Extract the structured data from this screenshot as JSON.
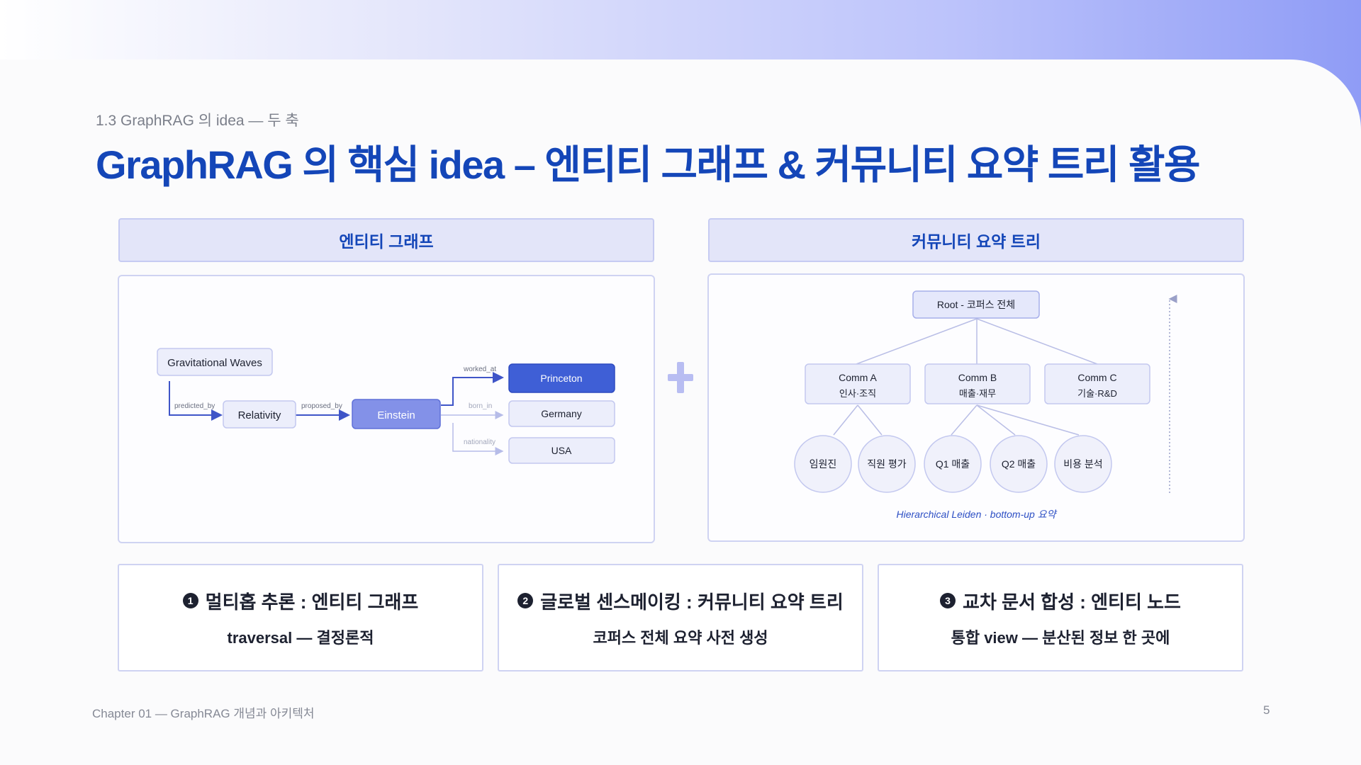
{
  "section_label": "1.3 GraphRAG 의 idea — 두 축",
  "title": "GraphRAG 의 핵심 idea – 엔티티 그래프 & 커뮤니티 요약 트리 활용",
  "left_header": "엔티티 그래프",
  "right_header": "커뮤니티 요약 트리",
  "entity_graph": {
    "nodes": {
      "waves": "Gravitational Waves",
      "relativity": "Relativity",
      "einstein": "Einstein",
      "princeton": "Princeton",
      "germany": "Germany",
      "usa": "USA"
    },
    "edges": {
      "predicted_by": "predicted_by",
      "proposed_by": "proposed_by",
      "worked_at": "worked_at",
      "born_in": "born_in",
      "nationality": "nationality"
    }
  },
  "community_tree": {
    "root": "Root - 코퍼스 전체",
    "comm_a": {
      "name": "Comm A",
      "sub": "인사·조직"
    },
    "comm_b": {
      "name": "Comm B",
      "sub": "매출·재무"
    },
    "comm_c": {
      "name": "Comm C",
      "sub": "기술·R&D"
    },
    "leaves": [
      "임원진",
      "직원 평가",
      "Q1 매출",
      "Q2 매출",
      "비용 분석"
    ],
    "caption": "Hierarchical Leiden · bottom-up 요약"
  },
  "cards": [
    {
      "num": "1",
      "head": "멀티홉 추론 : 엔티티 그래프",
      "sub": "traversal — 결정론적"
    },
    {
      "num": "2",
      "head": "글로벌 센스메이킹 : 커뮤니티 요약 트리",
      "sub": "코퍼스 전체 요약 사전 생성"
    },
    {
      "num": "3",
      "head": "교차 문서 합성 : 엔티티 노드",
      "sub": "통합 view — 분산된 정보 한 곳에"
    }
  ],
  "footer": {
    "chapter": "Chapter 01 — GraphRAG 개념과 아키텍처",
    "page": "5"
  },
  "colors": {
    "title": "#1446b8",
    "einstein_node": "#8391e8",
    "princeton_node": "#3f5fd6",
    "node_fill": "#eceefb",
    "arrow": "#3f55c8"
  }
}
